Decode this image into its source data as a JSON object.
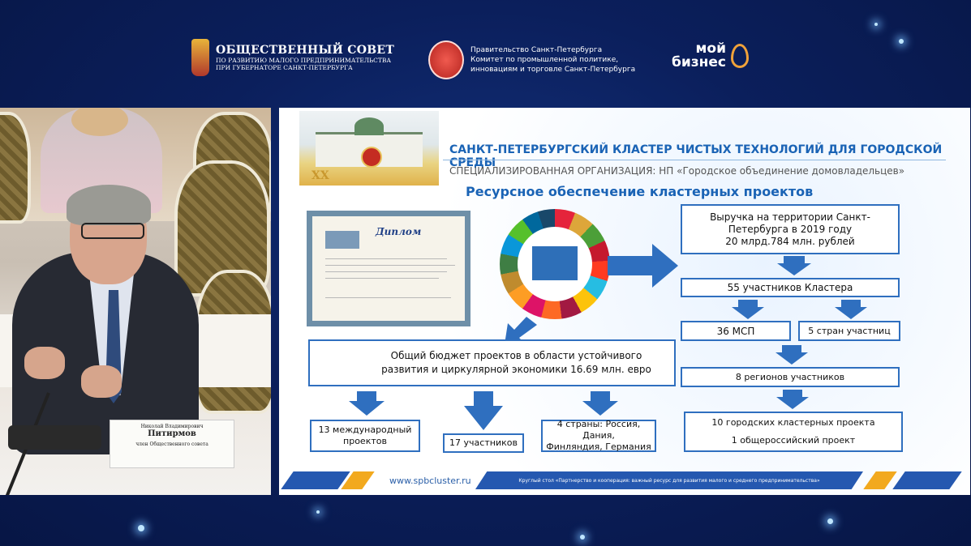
{
  "header": {
    "public_council": {
      "name": "ОБЩЕСТВЕННЫЙ СОВЕТ",
      "line2": "ПО РАЗВИТИЮ МАЛОГО ПРЕДПРИНИМАТЕЛЬСТВА",
      "line3": "ПРИ ГУБЕРНАТОРЕ САНКТ-ПЕТЕРБУРГА"
    },
    "government": {
      "line1": "Правительство Санкт-Петербурга",
      "line2": "Комитет по промышленной политике,",
      "line3": "инновациям и торговле Санкт-Петербурга"
    },
    "my_business": {
      "line1": "мой",
      "line2": "бизнес"
    }
  },
  "video": {
    "nameplate": {
      "first_name": "Николай Владимирович",
      "last_name": "Питирмов",
      "role": "член Общественного совета"
    }
  },
  "slide": {
    "palace_xx": "XX",
    "title": "САНКТ-ПЕТЕРБУРГСКИЙ КЛАСТЕР ЧИСТЫХ ТЕХНОЛОГИЙ ДЛЯ ГОРОДСКОЙ СРЕДЫ",
    "subtitle": "СПЕЦИАЛИЗИРОВАННАЯ ОРГАНИЗАЦИЯ: НП «Городское объединение домовладельцев»",
    "heading": "Ресурсное обеспечение кластерных проектов",
    "diploma_title": "Диплом",
    "revenue": {
      "line1": "Выручка на территории Санкт-",
      "line2": "Петербурга  в 2019 году",
      "line3": "20 млрд.784 млн. рублей"
    },
    "participants": "55 участников Кластера",
    "sme": "36 МСП",
    "countries": "5 стран участниц",
    "regions": "8 регионов участников",
    "cluster_projects": {
      "line1": "10 городских кластерных проекта",
      "line2": "1 общероссийский проект"
    },
    "budget": {
      "line1": "Общий бюджет проектов в области устойчивого",
      "line2": "развития и циркулярной экономики 16.69 млн. евро"
    },
    "intl_projects": {
      "line1": "13 международный",
      "line2": "проектов"
    },
    "participants17": "17 участников",
    "four_countries": {
      "line1": "4 страны: Россия, Дания,",
      "line2": "Финляндия, Германия"
    },
    "footer_url": "www.spbcluster.ru",
    "footer_text": "Круглый стол «Партнерство и кооперация: важный ресурс для развития малого и среднего предпринимательства»"
  },
  "colors": {
    "accent_blue": "#2f6fbf",
    "title_blue": "#1a63b5",
    "stripe_orange": "#f2a91e"
  }
}
